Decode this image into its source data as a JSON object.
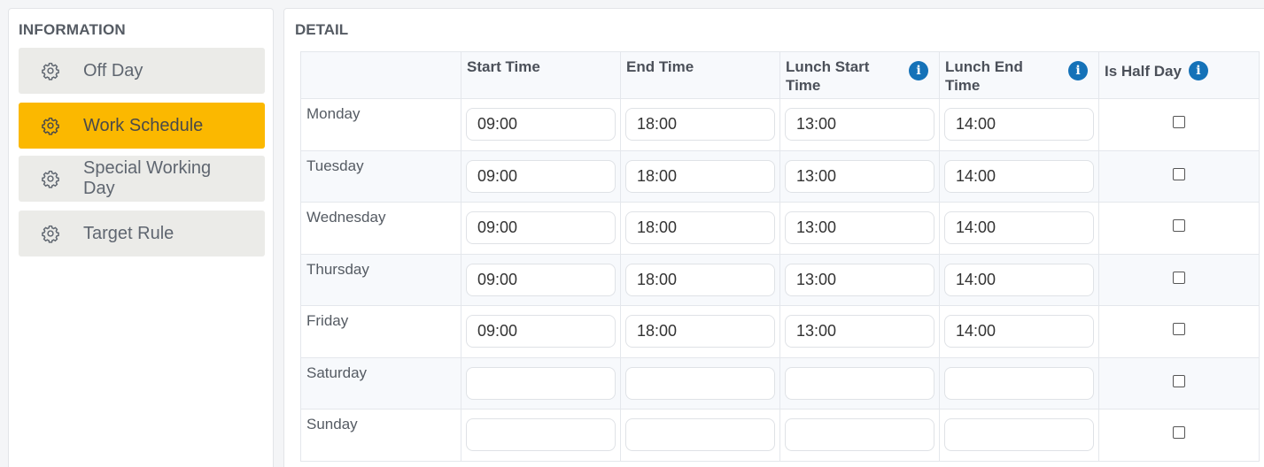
{
  "sidebar": {
    "title": "INFORMATION",
    "items": [
      {
        "label": "Off Day",
        "icon": "gear-icon",
        "active": false
      },
      {
        "label": "Work Schedule",
        "icon": "gear-icon",
        "active": true
      },
      {
        "label": "Special Working Day",
        "icon": "gear-icon",
        "active": false
      },
      {
        "label": "Target Rule",
        "icon": "gear-icon",
        "active": false
      }
    ],
    "active_color": "#fbb800"
  },
  "detail": {
    "title": "DETAIL",
    "columns": {
      "start": "Start Time",
      "end": "End Time",
      "lunch_start": "Lunch Start Time",
      "lunch_end": "Lunch End Time",
      "half_day": "Is Half Day"
    },
    "info_icon": "i",
    "rows": [
      {
        "day": "Monday",
        "start": "09:00",
        "end": "18:00",
        "lunch_start": "13:00",
        "lunch_end": "14:00",
        "half_day": false
      },
      {
        "day": "Tuesday",
        "start": "09:00",
        "end": "18:00",
        "lunch_start": "13:00",
        "lunch_end": "14:00",
        "half_day": false
      },
      {
        "day": "Wednesday",
        "start": "09:00",
        "end": "18:00",
        "lunch_start": "13:00",
        "lunch_end": "14:00",
        "half_day": false
      },
      {
        "day": "Thursday",
        "start": "09:00",
        "end": "18:00",
        "lunch_start": "13:00",
        "lunch_end": "14:00",
        "half_day": false
      },
      {
        "day": "Friday",
        "start": "09:00",
        "end": "18:00",
        "lunch_start": "13:00",
        "lunch_end": "14:00",
        "half_day": false
      },
      {
        "day": "Saturday",
        "start": "",
        "end": "",
        "lunch_start": "",
        "lunch_end": "",
        "half_day": false
      },
      {
        "day": "Sunday",
        "start": "",
        "end": "",
        "lunch_start": "",
        "lunch_end": "",
        "half_day": false
      }
    ]
  }
}
